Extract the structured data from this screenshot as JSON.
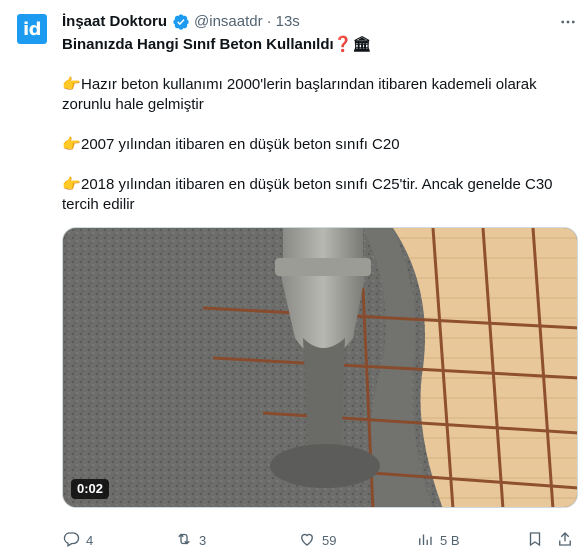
{
  "tweet": {
    "avatar_text": "id",
    "author_name": "İnşaat Doktoru",
    "handle": "@insaatdr",
    "separator": "·",
    "time": "13s",
    "title": "Binanızda Hangi Sınıf Beton Kullanıldı",
    "title_emojis": "❓🏛",
    "paragraphs": [
      "Hazır beton kullanımı 2000'lerin başlarından itibaren kademeli olarak zorunlu hale gelmiştir",
      "2007 yılından itibaren en düşük beton sınıfı C20",
      "2018 yılından itibaren en düşük beton sınıfı C25'tir. Ancak genelde C30 tercih edilir"
    ],
    "pointing_emoji": "👉",
    "video_duration": "0:02"
  },
  "actions": {
    "replies": "4",
    "retweets": "3",
    "likes": "59",
    "views": "5 B"
  },
  "colors": {
    "accent": "#1d9bf0",
    "text": "#0f1419",
    "muted": "#536471"
  },
  "icons": [
    "verified-badge-icon",
    "more-icon",
    "reply-icon",
    "retweet-icon",
    "like-icon",
    "views-icon",
    "bookmark-icon",
    "share-icon"
  ]
}
